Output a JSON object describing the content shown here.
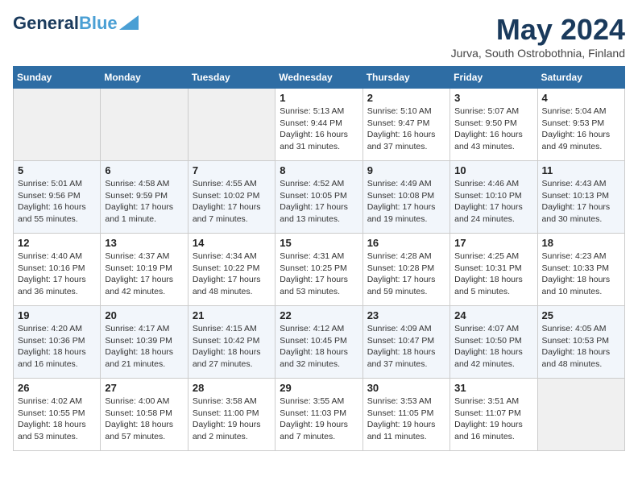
{
  "header": {
    "logo_general": "General",
    "logo_blue": "Blue",
    "title": "May 2024",
    "location": "Jurva, South Ostrobothnia, Finland"
  },
  "days_of_week": [
    "Sunday",
    "Monday",
    "Tuesday",
    "Wednesday",
    "Thursday",
    "Friday",
    "Saturday"
  ],
  "weeks": [
    [
      {
        "day": "",
        "info": ""
      },
      {
        "day": "",
        "info": ""
      },
      {
        "day": "",
        "info": ""
      },
      {
        "day": "1",
        "info": "Sunrise: 5:13 AM\nSunset: 9:44 PM\nDaylight: 16 hours and 31 minutes."
      },
      {
        "day": "2",
        "info": "Sunrise: 5:10 AM\nSunset: 9:47 PM\nDaylight: 16 hours and 37 minutes."
      },
      {
        "day": "3",
        "info": "Sunrise: 5:07 AM\nSunset: 9:50 PM\nDaylight: 16 hours and 43 minutes."
      },
      {
        "day": "4",
        "info": "Sunrise: 5:04 AM\nSunset: 9:53 PM\nDaylight: 16 hours and 49 minutes."
      }
    ],
    [
      {
        "day": "5",
        "info": "Sunrise: 5:01 AM\nSunset: 9:56 PM\nDaylight: 16 hours and 55 minutes."
      },
      {
        "day": "6",
        "info": "Sunrise: 4:58 AM\nSunset: 9:59 PM\nDaylight: 17 hours and 1 minute."
      },
      {
        "day": "7",
        "info": "Sunrise: 4:55 AM\nSunset: 10:02 PM\nDaylight: 17 hours and 7 minutes."
      },
      {
        "day": "8",
        "info": "Sunrise: 4:52 AM\nSunset: 10:05 PM\nDaylight: 17 hours and 13 minutes."
      },
      {
        "day": "9",
        "info": "Sunrise: 4:49 AM\nSunset: 10:08 PM\nDaylight: 17 hours and 19 minutes."
      },
      {
        "day": "10",
        "info": "Sunrise: 4:46 AM\nSunset: 10:10 PM\nDaylight: 17 hours and 24 minutes."
      },
      {
        "day": "11",
        "info": "Sunrise: 4:43 AM\nSunset: 10:13 PM\nDaylight: 17 hours and 30 minutes."
      }
    ],
    [
      {
        "day": "12",
        "info": "Sunrise: 4:40 AM\nSunset: 10:16 PM\nDaylight: 17 hours and 36 minutes."
      },
      {
        "day": "13",
        "info": "Sunrise: 4:37 AM\nSunset: 10:19 PM\nDaylight: 17 hours and 42 minutes."
      },
      {
        "day": "14",
        "info": "Sunrise: 4:34 AM\nSunset: 10:22 PM\nDaylight: 17 hours and 48 minutes."
      },
      {
        "day": "15",
        "info": "Sunrise: 4:31 AM\nSunset: 10:25 PM\nDaylight: 17 hours and 53 minutes."
      },
      {
        "day": "16",
        "info": "Sunrise: 4:28 AM\nSunset: 10:28 PM\nDaylight: 17 hours and 59 minutes."
      },
      {
        "day": "17",
        "info": "Sunrise: 4:25 AM\nSunset: 10:31 PM\nDaylight: 18 hours and 5 minutes."
      },
      {
        "day": "18",
        "info": "Sunrise: 4:23 AM\nSunset: 10:33 PM\nDaylight: 18 hours and 10 minutes."
      }
    ],
    [
      {
        "day": "19",
        "info": "Sunrise: 4:20 AM\nSunset: 10:36 PM\nDaylight: 18 hours and 16 minutes."
      },
      {
        "day": "20",
        "info": "Sunrise: 4:17 AM\nSunset: 10:39 PM\nDaylight: 18 hours and 21 minutes."
      },
      {
        "day": "21",
        "info": "Sunrise: 4:15 AM\nSunset: 10:42 PM\nDaylight: 18 hours and 27 minutes."
      },
      {
        "day": "22",
        "info": "Sunrise: 4:12 AM\nSunset: 10:45 PM\nDaylight: 18 hours and 32 minutes."
      },
      {
        "day": "23",
        "info": "Sunrise: 4:09 AM\nSunset: 10:47 PM\nDaylight: 18 hours and 37 minutes."
      },
      {
        "day": "24",
        "info": "Sunrise: 4:07 AM\nSunset: 10:50 PM\nDaylight: 18 hours and 42 minutes."
      },
      {
        "day": "25",
        "info": "Sunrise: 4:05 AM\nSunset: 10:53 PM\nDaylight: 18 hours and 48 minutes."
      }
    ],
    [
      {
        "day": "26",
        "info": "Sunrise: 4:02 AM\nSunset: 10:55 PM\nDaylight: 18 hours and 53 minutes."
      },
      {
        "day": "27",
        "info": "Sunrise: 4:00 AM\nSunset: 10:58 PM\nDaylight: 18 hours and 57 minutes."
      },
      {
        "day": "28",
        "info": "Sunrise: 3:58 AM\nSunset: 11:00 PM\nDaylight: 19 hours and 2 minutes."
      },
      {
        "day": "29",
        "info": "Sunrise: 3:55 AM\nSunset: 11:03 PM\nDaylight: 19 hours and 7 minutes."
      },
      {
        "day": "30",
        "info": "Sunrise: 3:53 AM\nSunset: 11:05 PM\nDaylight: 19 hours and 11 minutes."
      },
      {
        "day": "31",
        "info": "Sunrise: 3:51 AM\nSunset: 11:07 PM\nDaylight: 19 hours and 16 minutes."
      },
      {
        "day": "",
        "info": ""
      }
    ]
  ]
}
